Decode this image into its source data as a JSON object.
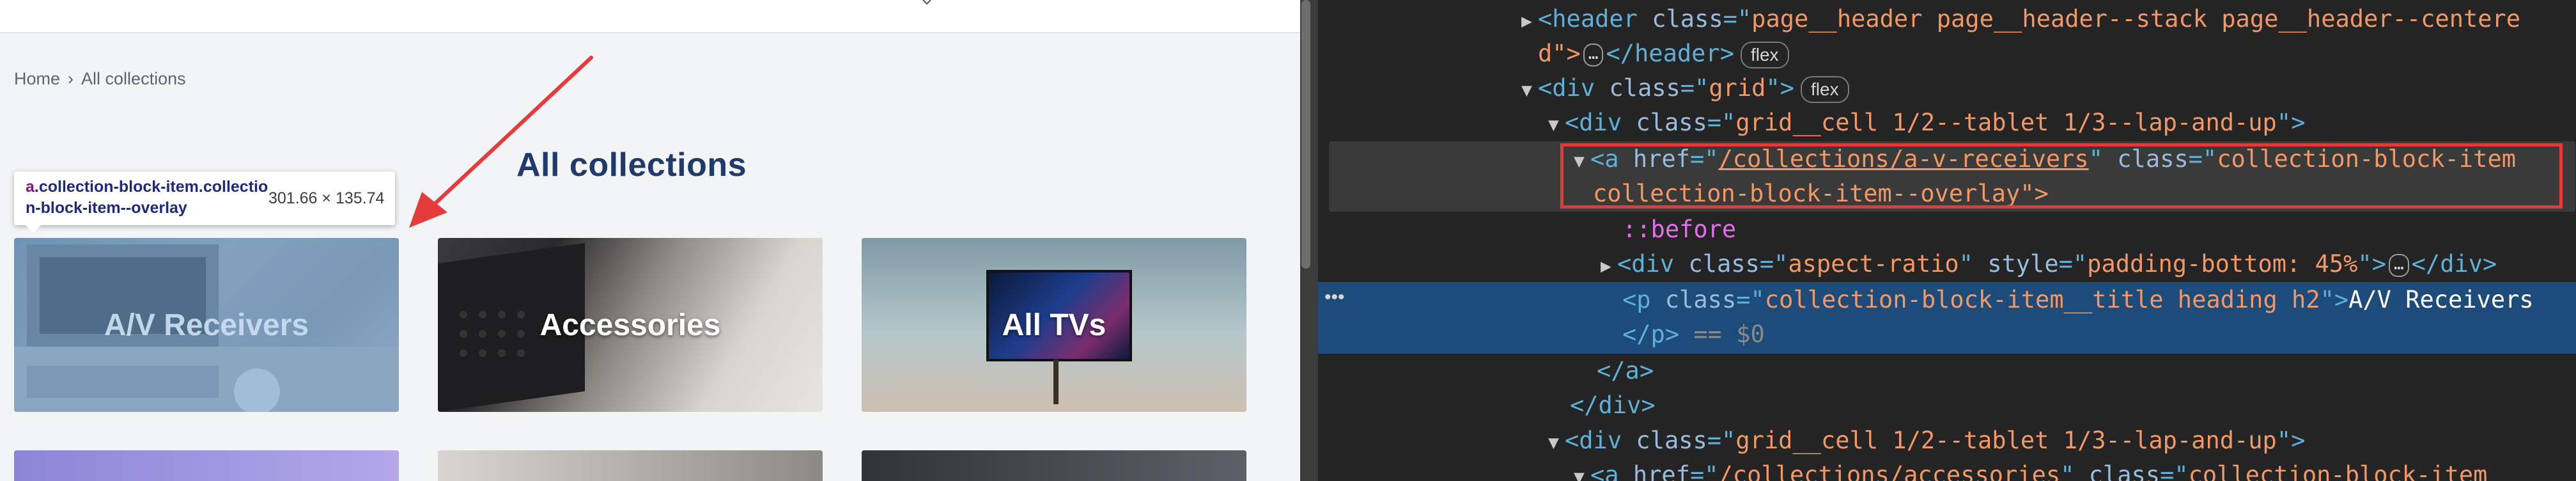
{
  "webpage": {
    "breadcrumb": {
      "home": "Home",
      "separator": "›",
      "current": "All collections"
    },
    "title": "All collections",
    "tooltip": {
      "element_tag": "a",
      "element_classes": ".collection-block-item.collection-block-item--overlay",
      "size": "301.66 × 135.74"
    },
    "collections": [
      {
        "title": "A/V Receivers"
      },
      {
        "title": "Accessories"
      },
      {
        "title": "All TVs"
      }
    ]
  },
  "devtools": {
    "lines": [
      {
        "indent": 0,
        "toggle": "▶",
        "html": "header",
        "attrs": [
          {
            "n": "class",
            "v": "page__header page__header--stack page__header--centere"
          }
        ]
      },
      {
        "indent": 1,
        "continuation": "d\">",
        "ellipsis": "…",
        "close": "</header>",
        "pill": "flex"
      },
      {
        "indent": 0,
        "toggle": "▼",
        "html": "div",
        "attrs": [
          {
            "n": "class",
            "v": "grid"
          }
        ],
        "pill": "flex"
      },
      {
        "indent": 1,
        "toggle": "▼",
        "html": "div",
        "attrs": [
          {
            "n": "class",
            "v": "grid__cell 1/2--tablet 1/3--lap-and-up"
          }
        ]
      },
      {
        "indent": 2,
        "toggle": "▼",
        "html": "a",
        "attrs": [
          {
            "n": "href",
            "v": "/collections/a-v-receivers"
          },
          {
            "n": "class",
            "v": "collection-block-item"
          }
        ]
      },
      {
        "indent": 3,
        "continuation_attr": "collection-block-item--overlay\">"
      },
      {
        "indent": 3,
        "pseudo": "::before"
      },
      {
        "indent": 3,
        "toggle": "▶",
        "html": "div",
        "attrs": [
          {
            "n": "class",
            "v": "aspect-ratio"
          },
          {
            "n": "style",
            "v": "padding-bottom: 45%"
          }
        ],
        "ellipsis": "…",
        "close": "</div>"
      },
      {
        "indent": 3,
        "html": "p",
        "attrs": [
          {
            "n": "class",
            "v": "collection-block-item__title heading h2"
          }
        ],
        "text": "A/V Receivers"
      },
      {
        "indent": 3,
        "close_tag": "</p>",
        "dollar": "== $0"
      },
      {
        "indent": 2,
        "close_tag": "</a>"
      },
      {
        "indent": 1,
        "close_tag": "</div>"
      },
      {
        "indent": 1,
        "toggle": "▼",
        "html": "div",
        "attrs": [
          {
            "n": "class",
            "v": "grid__cell 1/2--tablet 1/3--lap-and-up"
          }
        ]
      },
      {
        "indent": 2,
        "toggle": "▼",
        "html": "a",
        "attrs": [
          {
            "n": "href",
            "v": "/collections/accessories"
          },
          {
            "n": "class",
            "v": "collection-block-item"
          }
        ]
      }
    ],
    "selected_dots": "•••",
    "colors": {
      "background": "#242424",
      "selected": "#1e4c7a",
      "tag": "#5db0d7",
      "attr_name": "#9bbbdc",
      "attr_value": "#f29766",
      "highlight_border": "#e33b3b"
    }
  }
}
